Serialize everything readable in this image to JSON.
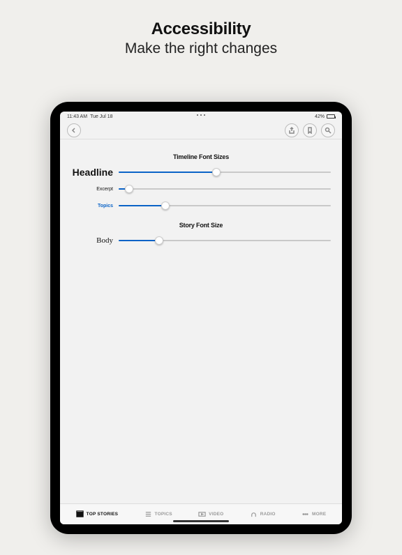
{
  "promo": {
    "title": "Accessibility",
    "subtitle": "Make the right changes"
  },
  "status": {
    "time": "11:43 AM",
    "date": "Tue Jul 18",
    "battery": "42%"
  },
  "sections": {
    "timeline_title": "Timeline Font Sizes",
    "story_title": "Story Font Size"
  },
  "sliders": {
    "headline": {
      "label": "Headline",
      "pct": 46
    },
    "excerpt": {
      "label": "Excerpt",
      "pct": 5
    },
    "topics": {
      "label": "Topics",
      "pct": 22
    },
    "body": {
      "label": "Body",
      "pct": 19
    }
  },
  "tabs": {
    "top": "TOP STORIES",
    "topics": "TOPICS",
    "video": "VIDEO",
    "radio": "RADIO",
    "more": "MORE"
  }
}
